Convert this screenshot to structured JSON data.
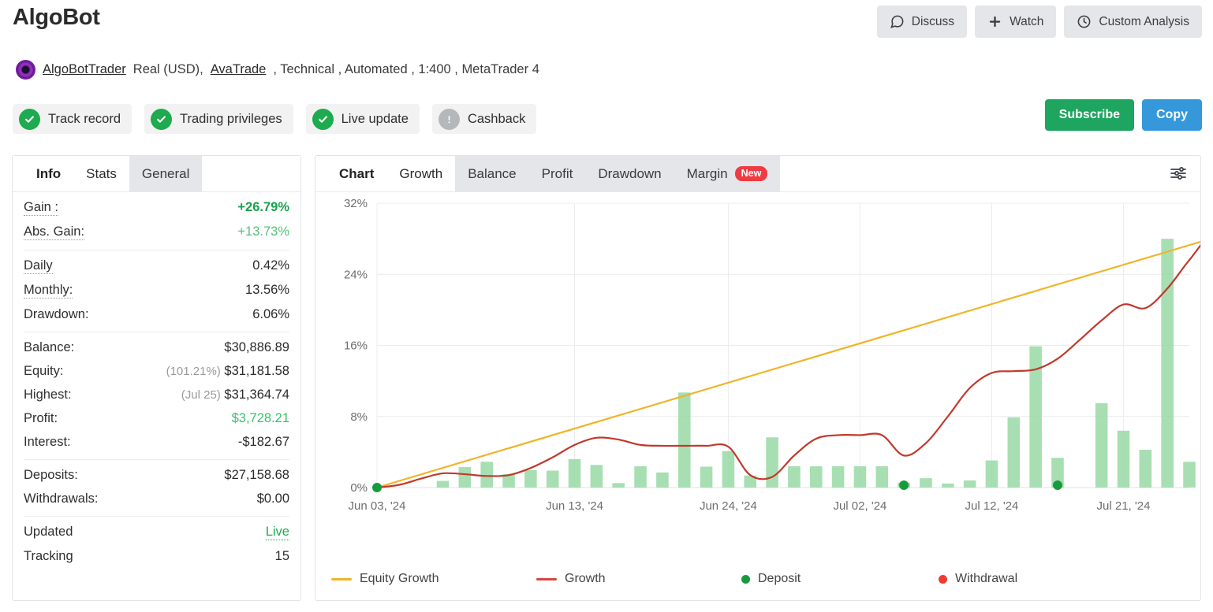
{
  "header": {
    "title": "AlgoBot",
    "actions": [
      {
        "label": "Discuss",
        "icon": "comment-icon"
      },
      {
        "label": "Watch",
        "icon": "plus-icon"
      },
      {
        "label": "Custom Analysis",
        "icon": "clock-icon"
      }
    ],
    "cta": [
      {
        "label": "Subscribe",
        "color": "#1ea55f"
      },
      {
        "label": "Copy",
        "color": "#3498db"
      }
    ]
  },
  "account": {
    "trader": "AlgoBotTrader",
    "type": "Real (USD),",
    "broker": "AvaTrade",
    "rest": ", Technical , Automated , 1:400 , MetaTrader 4"
  },
  "badges": [
    {
      "label": "Track record",
      "state": "ok"
    },
    {
      "label": "Trading privileges",
      "state": "ok"
    },
    {
      "label": "Live update",
      "state": "ok"
    },
    {
      "label": "Cashback",
      "state": "off"
    }
  ],
  "left_panel": {
    "tabs": [
      {
        "label": "Info",
        "style": "lead"
      },
      {
        "label": "Stats",
        "style": "active"
      },
      {
        "label": "General",
        "style": "idle"
      }
    ],
    "groups": [
      {
        "rows": [
          {
            "key": "Gain :",
            "value": "+26.79%",
            "key_style": "dotted",
            "value_style": "green-bold"
          },
          {
            "key": "Abs. Gain:",
            "value": "+13.73%",
            "key_style": "dotted",
            "value_style": "green"
          }
        ]
      },
      {
        "rows": [
          {
            "key": "Daily",
            "value": "0.42%",
            "key_style": "dotted",
            "value_style": ""
          },
          {
            "key": "Monthly:",
            "value": "13.56%",
            "key_style": "dotted",
            "value_style": ""
          },
          {
            "key": "Drawdown:",
            "value": "6.06%",
            "key_style": "",
            "value_style": ""
          }
        ]
      },
      {
        "rows": [
          {
            "key": "Balance:",
            "value": "$30,886.89",
            "key_style": "",
            "value_style": ""
          },
          {
            "key": "Equity:",
            "prefix": "(101.21%)",
            "value": "$31,181.58",
            "key_style": "",
            "value_style": ""
          },
          {
            "key": "Highest:",
            "prefix": "(Jul 25)",
            "value": "$31,364.74",
            "key_style": "",
            "value_style": ""
          },
          {
            "key": "Profit:",
            "value": "$3,728.21",
            "key_style": "",
            "value_style": "profit"
          },
          {
            "key": "Interest:",
            "value": "-$182.67",
            "key_style": "",
            "value_style": ""
          }
        ]
      },
      {
        "rows": [
          {
            "key": "Deposits:",
            "value": "$27,158.68",
            "key_style": "",
            "value_style": ""
          },
          {
            "key": "Withdrawals:",
            "value": "$0.00",
            "key_style": "",
            "value_style": ""
          }
        ]
      },
      {
        "rows": [
          {
            "key": "Updated",
            "value": "Live",
            "key_style": "",
            "value_style": "live"
          },
          {
            "key": "Tracking",
            "value": "15",
            "key_style": "",
            "value_style": ""
          }
        ]
      }
    ]
  },
  "right_panel": {
    "tabs": [
      {
        "label": "Chart",
        "style": "lead",
        "badge": ""
      },
      {
        "label": "Growth",
        "style": "active",
        "badge": ""
      },
      {
        "label": "Balance",
        "style": "idle",
        "badge": ""
      },
      {
        "label": "Profit",
        "style": "idle",
        "badge": ""
      },
      {
        "label": "Drawdown",
        "style": "idle",
        "badge": ""
      },
      {
        "label": "Margin",
        "style": "idle",
        "badge": "New"
      }
    ],
    "settings_icon": "sliders-icon"
  },
  "chart_data": {
    "type": "line",
    "title": "",
    "xlabel": "",
    "ylabel": "",
    "grid": true,
    "legend_position": "bottom",
    "ylim": [
      0,
      32
    ],
    "yticks": [
      0,
      8,
      16,
      24,
      32
    ],
    "ytick_labels": [
      "0%",
      "8%",
      "16%",
      "24%",
      "32%"
    ],
    "xtick_labels": [
      "Jun 03, '24",
      "Jun 13, '24",
      "Jun 24, '24",
      "Jul 02, '24",
      "Jul 12, '24",
      "Jul 21, '24"
    ],
    "xtick_index": [
      0,
      9,
      16,
      22,
      28,
      34
    ],
    "n_points": 38,
    "legend": [
      {
        "name": "Equity Growth",
        "type": "line",
        "color": "#f0b429"
      },
      {
        "name": "Growth",
        "type": "line",
        "color": "#d9453f"
      },
      {
        "name": "Deposit",
        "type": "dot",
        "color": "#179b3c"
      },
      {
        "name": "Withdrawal",
        "type": "dot",
        "color": "#ee3b33"
      }
    ],
    "series": [
      {
        "name": "Growth",
        "type": "line",
        "color": "#c0392b",
        "values": [
          0.0,
          0.3,
          1.0,
          1.6,
          1.5,
          1.3,
          1.4,
          2.2,
          3.4,
          4.8,
          5.6,
          5.4,
          4.8,
          4.7,
          4.7,
          4.7,
          4.6,
          1.4,
          1.2,
          3.6,
          5.5,
          5.9,
          5.9,
          5.9,
          3.6,
          5.0,
          8.0,
          11.2,
          12.9,
          13.1,
          13.3,
          14.5,
          16.6,
          18.8,
          20.6,
          20.2,
          22.4,
          25.6,
          28.2,
          26.2,
          27.3
        ]
      },
      {
        "name": "Equity Growth",
        "type": "line",
        "color": "#f0b429",
        "values": [
          0.0,
          0.75,
          1.5,
          2.25,
          3.0,
          3.75,
          4.5,
          5.25,
          6.0,
          6.75,
          7.5,
          8.25,
          9.0,
          9.75,
          10.5,
          11.25,
          12.0,
          12.75,
          13.5,
          14.25,
          15.0,
          15.75,
          16.5,
          17.25,
          18.0,
          18.75,
          19.5,
          20.25,
          21.0,
          21.75,
          22.5,
          23.25,
          24.0,
          24.75,
          25.5,
          26.25,
          27.0,
          27.75,
          28.5,
          29.0,
          29.5
        ]
      },
      {
        "name": "Daily bars",
        "type": "bar",
        "color": "#98d9a4",
        "values": [
          0.0,
          0.0,
          0.75,
          2.3,
          2.9,
          1.5,
          1.95,
          1.9,
          3.2,
          2.55,
          0.5,
          2.4,
          1.7,
          10.7,
          2.35,
          4.1,
          1.35,
          5.65,
          2.4,
          2.4,
          2.4,
          2.4,
          2.4,
          0.55,
          1.05,
          0.45,
          0.8,
          3.05,
          7.9,
          15.9,
          3.35,
          0.0,
          9.5,
          6.4,
          4.25,
          28.0,
          2.9
        ]
      }
    ],
    "markers": [
      {
        "type": "Deposit",
        "index": 0,
        "color": "#179b3c"
      },
      {
        "type": "Deposit",
        "index": 24,
        "color": "#179b3c"
      },
      {
        "type": "Deposit",
        "index": 31,
        "color": "#179b3c"
      }
    ]
  }
}
